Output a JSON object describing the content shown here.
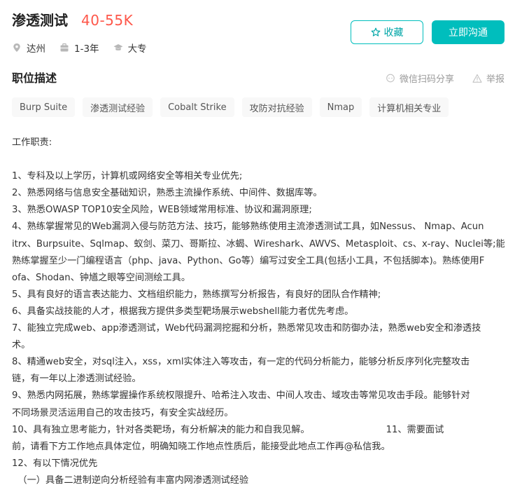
{
  "job": {
    "title": "渗透测试",
    "salary": "40-55K",
    "location": "达州",
    "experience": "1-3年",
    "education": "大专"
  },
  "buttons": {
    "favorite": "收藏",
    "chat": "立即沟通"
  },
  "section": {
    "title": "职位描述",
    "share": "微信扫码分享",
    "report": "举报"
  },
  "tags": [
    "Burp Suite",
    "渗透测试经验",
    "Cobalt Strike",
    "攻防对抗经验",
    "Nmap",
    "计算机相关专业"
  ],
  "description": {
    "heading": "工作职责:",
    "lines": [
      "1、专科及以上学历，计算机或网络安全等相关专业优先;",
      "2、熟悉网络与信息安全基础知识，熟悉主流操作系统、中间件、数据库等。",
      "3、熟悉OWASP TOP10安全风险，WEB领域常用标准、协议和漏洞原理;",
      "4、熟练掌握常见的Web漏洞入侵与防范方法、技巧，能够熟练使用主流渗透测试工具，如Nessus、 Nmap、Acun",
      "itrx、Burpsuite、Sqlmap、蚁剑、菜刀、哥斯拉、冰蝎、Wireshark、AWVS、Metasploit、cs、x-ray、Nuclei等;能",
      "熟练掌握至少一门编程语言（php、java、Python、Go等）编写过安全工具(包括小工具，不包括脚本)。熟练使用F",
      "ofa、Shodan、钟馗之眼等空间测绘工具。",
      "5、具有良好的语言表达能力、文档组织能力，熟练撰写分析报告，有良好的团队合作精神;",
      "6、具备实战技能的人才，根据我方提供多类型靶场展示webshell能力者优先考虑。",
      "7、能独立完成web、app渗透测试，Web代码漏洞挖掘和分析，熟悉常见攻击和防御办法，熟悉web安全和渗透技",
      "术。",
      "8、精通web安全，对sql注入，xss，xml实体注入等攻击，有一定的代码分析能力，能够分析反序列化完整攻击",
      "链，有一年以上渗透测试经验。",
      "9、熟悉内网拓展，熟练掌握操作系统权限提升、哈希注入攻击、中间人攻击、域攻击等常见攻击手段。能够针对",
      "不同场景灵活运用自己的攻击技巧，有安全实战经历。",
      "10、具有独立思考能力，针对各类靶场，有分析解决的能力和自我见解。                          11、需要面试",
      "前，请看下方工作地点具体定位，明确知晓工作地点性质后，能接受此地点工作再@私信我。",
      "12、有以下情况优先",
      "  （一）具备二进制逆向分析经验有丰富内网渗透测试经验"
    ]
  },
  "colors": {
    "accent": "#00bebd",
    "salary": "#fe574a",
    "tag_bg": "#f8f8f8",
    "muted": "#999999"
  },
  "icons": [
    "location-icon",
    "briefcase-icon",
    "graduation-cap-icon",
    "star-icon",
    "chat-bubble-icon",
    "warning-icon"
  ]
}
